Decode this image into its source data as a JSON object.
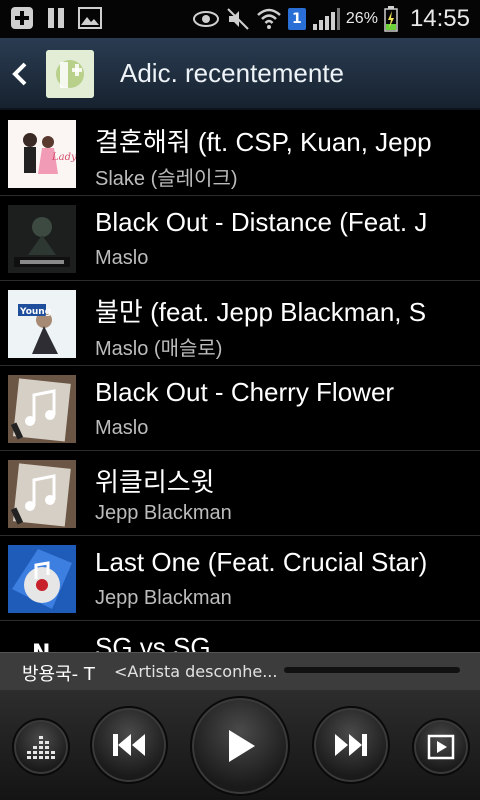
{
  "status_bar": {
    "battery_percent": "26%",
    "time": "14:55",
    "sim_number": "1"
  },
  "action_bar": {
    "title": "Adic. recentemente"
  },
  "songs": [
    {
      "title": "결혼해줘 (ft. CSP, Kuan, Jepp",
      "artist": "Slake (슬레이크)",
      "art": "couple"
    },
    {
      "title": "Black Out - Distance (Feat. J",
      "artist": "Maslo",
      "art": "dark-figure"
    },
    {
      "title": "불만 (feat. Jepp Blackman, S",
      "artist": "Maslo (매슬로)",
      "art": "young"
    },
    {
      "title": "Black Out - Cherry Flower",
      "artist": "Maslo",
      "art": "default-note"
    },
    {
      "title": "위클리스윗",
      "artist": "Jepp Blackman",
      "art": "default-note"
    },
    {
      "title": "Last One (Feat. Crucial Star)",
      "artist": "Jepp Blackman",
      "art": "blue-record"
    },
    {
      "title": "SG vs SG",
      "artist": "",
      "art": "black"
    }
  ],
  "now_playing": {
    "title": "방용국- T",
    "artist": "<Artista desconhe...",
    "progress": 0.0
  },
  "colors": {
    "action_bar_top": "#2a3c52",
    "action_bar_bottom": "#17222f",
    "now_bar": "#3c3c3c",
    "artist_text": "#bcbcbc"
  }
}
